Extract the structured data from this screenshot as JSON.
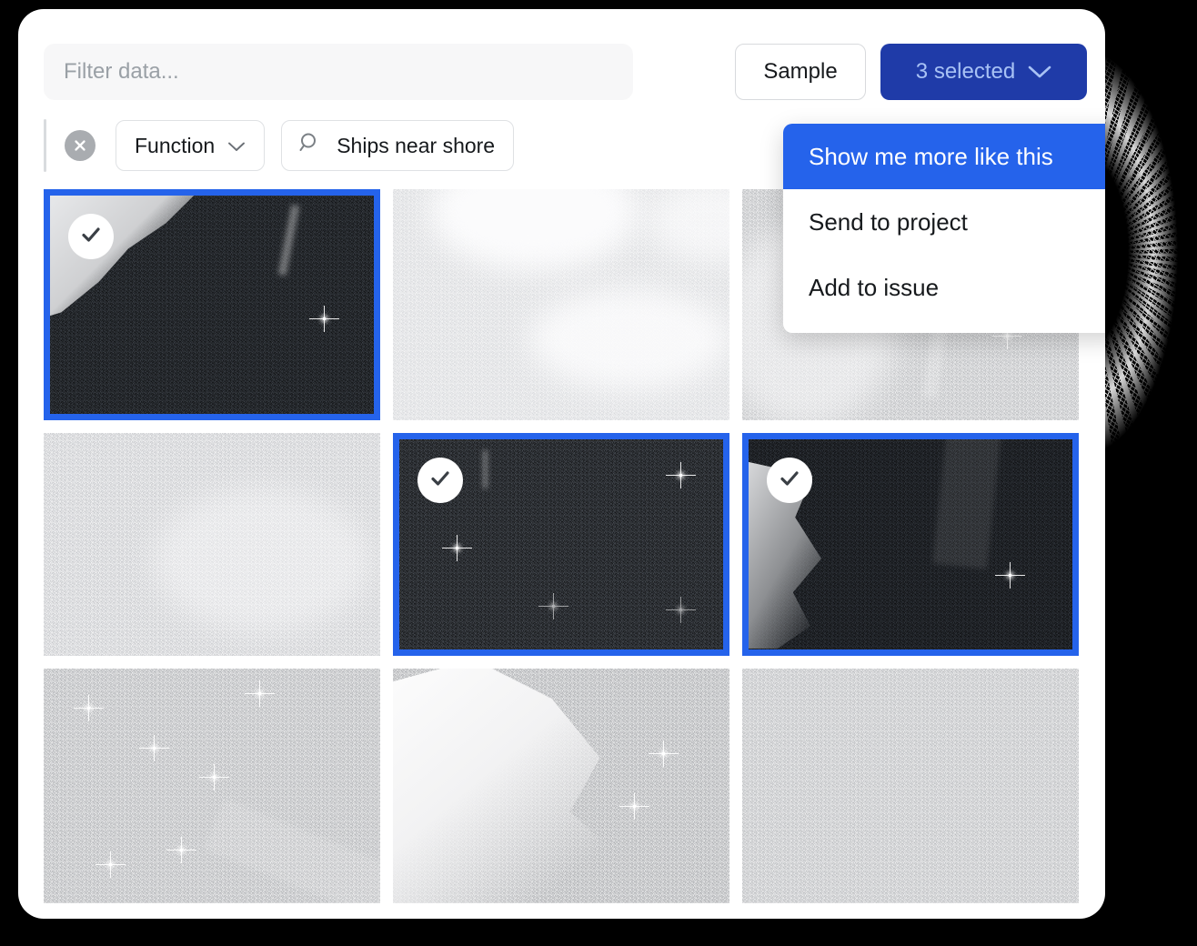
{
  "theme": {
    "panel_bg": "#ffffff",
    "page_bg": "#000000",
    "accent_blue": "#2563eb",
    "button_blue": "#1f3ba8",
    "button_blue_text": "#a8c2f5",
    "chip_border": "#dfe1e4",
    "clear_button_gray": "#a9acb0"
  },
  "toolbar": {
    "filter_placeholder": "Filter data...",
    "filter_value": "",
    "sample_label": "Sample",
    "selected_label": "3 selected",
    "selected_chevron_icon": "chevron-down-icon"
  },
  "filters": {
    "clear_icon": "close-circle-icon",
    "chips": [
      {
        "label": "Function",
        "icon": "chevron-down-icon",
        "type": "dropdown"
      },
      {
        "label": "Ships near shore",
        "icon": "search-icon",
        "type": "search"
      }
    ]
  },
  "menu": {
    "items": [
      {
        "label": "Show me more like this",
        "active": true
      },
      {
        "label": "Send to project",
        "active": false
      },
      {
        "label": "Add to issue",
        "active": false
      }
    ]
  },
  "grid": {
    "check_icon": "check-icon",
    "tiles": [
      {
        "id": "tile-1",
        "selected": true,
        "scene": "dark-water-coastline",
        "row": 1,
        "col": 1
      },
      {
        "id": "tile-2",
        "selected": false,
        "scene": "bright-clouds",
        "row": 1,
        "col": 2
      },
      {
        "id": "tile-3",
        "selected": false,
        "scene": "gray-speckle",
        "row": 1,
        "col": 3
      },
      {
        "id": "tile-4",
        "selected": false,
        "scene": "light-texture",
        "row": 2,
        "col": 1
      },
      {
        "id": "tile-5",
        "selected": true,
        "scene": "dark-water-ships",
        "row": 2,
        "col": 2
      },
      {
        "id": "tile-6",
        "selected": true,
        "scene": "dark-water-rocky-coast",
        "row": 2,
        "col": 3
      },
      {
        "id": "tile-7",
        "selected": false,
        "scene": "ships-and-shoreline",
        "row": 3,
        "col": 1
      },
      {
        "id": "tile-8",
        "selected": false,
        "scene": "bright-coastline",
        "row": 3,
        "col": 2
      },
      {
        "id": "tile-9",
        "selected": false,
        "scene": "uniform-gray",
        "row": 3,
        "col": 3
      }
    ]
  }
}
